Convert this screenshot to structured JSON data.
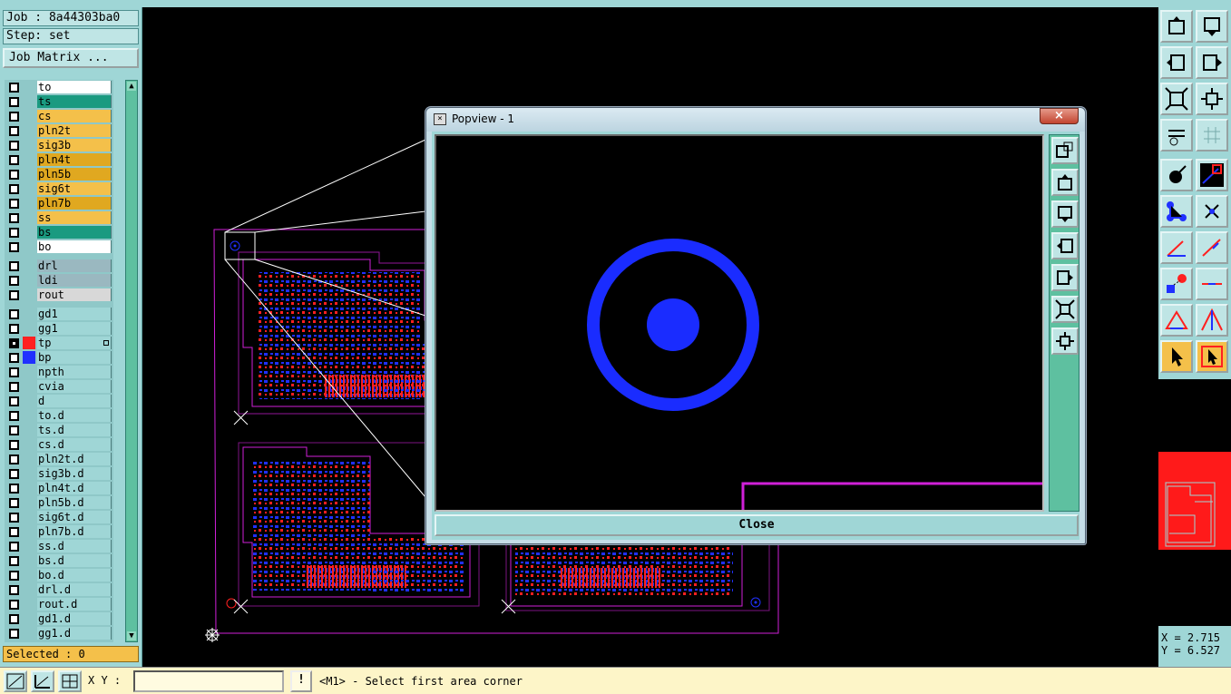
{
  "job": {
    "job_line": "Job : 8a44303ba0",
    "step_line": "Step: set",
    "matrix_button": "Job Matrix ..."
  },
  "layer_groups": [
    {
      "layers": [
        {
          "name": "to",
          "color": "#ffffff"
        },
        {
          "name": "ts",
          "color": "#1a9a80"
        },
        {
          "name": "cs",
          "color": "#f4c04a"
        },
        {
          "name": "pln2t",
          "color": "#f4c04a"
        },
        {
          "name": "sig3b",
          "color": "#f4c04a"
        },
        {
          "name": "pln4t",
          "color": "#e0a820"
        },
        {
          "name": "pln5b",
          "color": "#e0a820"
        },
        {
          "name": "sig6t",
          "color": "#f4c04a"
        },
        {
          "name": "pln7b",
          "color": "#e0a820"
        },
        {
          "name": "ss",
          "color": "#f4c04a"
        },
        {
          "name": "bs",
          "color": "#1a9a80"
        },
        {
          "name": "bo",
          "color": "#ffffff"
        }
      ]
    },
    {
      "layers": [
        {
          "name": "drl",
          "color": "#9ab8c0"
        },
        {
          "name": "ldi",
          "color": "#9ab8c0"
        },
        {
          "name": "rout",
          "color": "#d8d8d8"
        }
      ]
    },
    {
      "layers": [
        {
          "name": "gd1",
          "color": "#9fd6d6"
        },
        {
          "name": "gg1",
          "color": "#9fd6d6"
        },
        {
          "name": "tp",
          "color": "#9fd6d6",
          "active": true,
          "swatch": "#ff2020",
          "mark": true
        },
        {
          "name": "bp",
          "color": "#9fd6d6",
          "swatch": "#2030ff"
        },
        {
          "name": "npth",
          "color": "#9fd6d6"
        },
        {
          "name": "cvia",
          "color": "#9fd6d6"
        },
        {
          "name": "d",
          "color": "#9fd6d6"
        },
        {
          "name": "to.d",
          "color": "#9fd6d6"
        },
        {
          "name": "ts.d",
          "color": "#9fd6d6"
        },
        {
          "name": "cs.d",
          "color": "#9fd6d6"
        },
        {
          "name": "pln2t.d",
          "color": "#9fd6d6"
        },
        {
          "name": "sig3b.d",
          "color": "#9fd6d6"
        },
        {
          "name": "pln4t.d",
          "color": "#9fd6d6"
        },
        {
          "name": "pln5b.d",
          "color": "#9fd6d6"
        },
        {
          "name": "sig6t.d",
          "color": "#9fd6d6"
        },
        {
          "name": "pln7b.d",
          "color": "#9fd6d6"
        },
        {
          "name": "ss.d",
          "color": "#9fd6d6"
        },
        {
          "name": "bs.d",
          "color": "#9fd6d6"
        },
        {
          "name": "bo.d",
          "color": "#9fd6d6"
        },
        {
          "name": "drl.d",
          "color": "#9fd6d6"
        },
        {
          "name": "rout.d",
          "color": "#9fd6d6"
        },
        {
          "name": "gd1.d",
          "color": "#9fd6d6"
        },
        {
          "name": "gg1.d",
          "color": "#9fd6d6"
        }
      ]
    }
  ],
  "selected_label": "Selected : 0",
  "coords": {
    "x": "X = 2.715",
    "y": "Y = 6.527"
  },
  "bottom": {
    "xy_label": "X Y :",
    "xy_value": "",
    "warn_symbol": "!",
    "status_message": "<M1> - Select first area corner"
  },
  "popview": {
    "title": "Popview - 1",
    "close_x": "×",
    "close_button": "Close"
  },
  "colors": {
    "panel": "#9fd6d6",
    "pad_blue": "#1a2cff",
    "pad_red": "#ff1a1a",
    "outline_magenta": "#d020d8"
  }
}
